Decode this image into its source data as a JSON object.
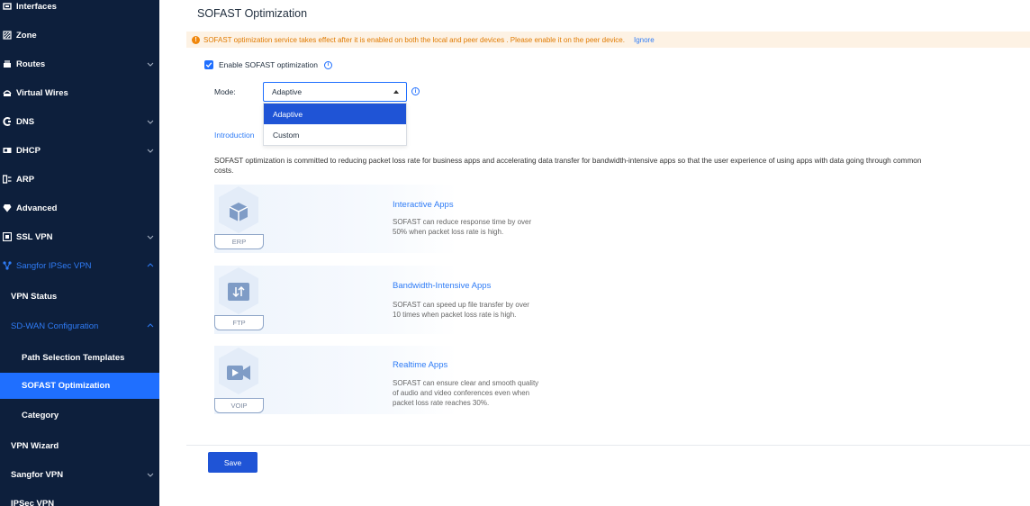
{
  "sidebar": {
    "items": [
      {
        "label": "Interfaces",
        "icon": "interfaces-icon"
      },
      {
        "label": "Zone",
        "icon": "zone-icon"
      },
      {
        "label": "Routes",
        "icon": "routes-icon"
      },
      {
        "label": "Virtual Wires",
        "icon": "virtual-wires-icon"
      },
      {
        "label": "DNS",
        "icon": "dns-icon"
      },
      {
        "label": "DHCP",
        "icon": "dhcp-icon"
      },
      {
        "label": "ARP",
        "icon": "arp-icon"
      },
      {
        "label": "Advanced",
        "icon": "advanced-icon"
      },
      {
        "label": "SSL VPN",
        "icon": "ssl-vpn-icon"
      },
      {
        "label": "Sangfor IPSec VPN",
        "icon": "sangfor-ipsec-vpn-icon"
      },
      {
        "label": "VPN Status"
      },
      {
        "label": "SD-WAN Configuration"
      },
      {
        "label": "Path Selection Templates"
      },
      {
        "label": "SOFAST Optimization"
      },
      {
        "label": "Category"
      },
      {
        "label": "VPN Wizard"
      },
      {
        "label": "Sangfor VPN"
      },
      {
        "label": "IPSec VPN"
      }
    ]
  },
  "page": {
    "title": "SOFAST Optimization",
    "notice": "SOFAST optimization service takes effect after it is enabled on both the local and peer devices . Please enable it on the peer device.",
    "notice_ignore": "Ignore",
    "enable_label": "Enable SOFAST optimization",
    "enable_checked": true,
    "mode_label": "Mode:",
    "mode_value": "Adaptive",
    "mode_options": [
      "Adaptive",
      "Custom"
    ],
    "intro_link": "Introduction",
    "description": "SOFAST optimization is committed to reducing packet loss rate for business apps and accelerating data transfer for bandwidth-intensive apps so that the user experience of using apps with data going through common",
    "description_line2": "costs.",
    "save_label": "Save"
  },
  "cards": [
    {
      "tag": "ERP",
      "title": "Interactive Apps",
      "line1": "SOFAST can reduce response time by over",
      "line2": "50% when packet loss rate is high.",
      "line3": "",
      "icon": "interactive-apps-icon"
    },
    {
      "tag": "FTP",
      "title": "Bandwidth-Intensive Apps",
      "line1": "SOFAST can speed up file transfer by over",
      "line2": "10 times when packet loss rate is high.",
      "line3": "",
      "icon": "bandwidth-apps-icon"
    },
    {
      "tag": "VOIP",
      "title": "Realtime Apps",
      "line1": "SOFAST can ensure clear and smooth quality",
      "line2": "of audio and video conferences even when",
      "line3": "packet loss rate reaches 30%.",
      "icon": "realtime-apps-icon"
    }
  ],
  "colors": {
    "sidebar_bg": "#0d1f3c",
    "accent": "#1f6fff",
    "primary_button": "#1f54d6",
    "notice_bg": "#fdf2e4",
    "notice_text": "#e07a00"
  }
}
